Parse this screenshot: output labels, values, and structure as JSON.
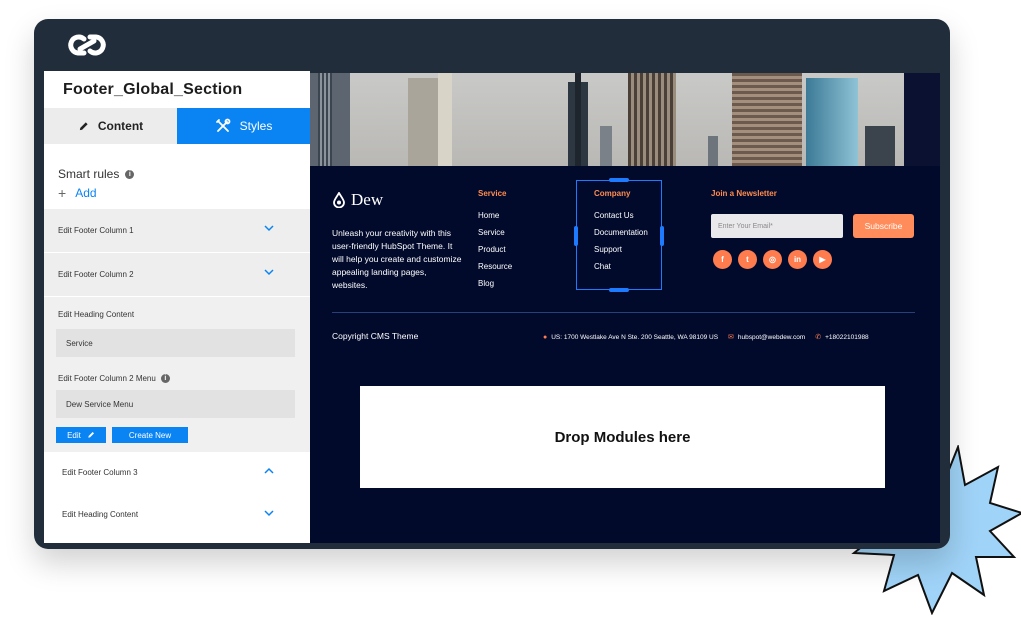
{
  "sidebar": {
    "title": "Footer_Global_Section",
    "tabs": [
      {
        "label": "Content"
      },
      {
        "label": "Styles"
      }
    ],
    "smart_rules_label": "Smart rules",
    "add_label": "Add",
    "rows": [
      {
        "label": "Edit Footer Column 1"
      },
      {
        "label": "Edit Footer Column 2"
      }
    ],
    "expanded": {
      "heading_label": "Edit Heading Content",
      "heading_value": "Service",
      "menu_label": "Edit Footer Column 2 Menu",
      "menu_value": "Dew Service Menu",
      "edit_button": "Edit",
      "create_button": "Create New"
    },
    "after_rows": [
      {
        "label": "Edit Footer Column 3"
      },
      {
        "label": "Edit Heading Content"
      }
    ]
  },
  "footer": {
    "brand": "Dew",
    "blurb": "Unleash your creativity with this user-friendly HubSpot Theme. It will help you create and customize appealing landing pages, websites.",
    "service": {
      "heading": "Service",
      "items": [
        "Home",
        "Service",
        "Product",
        "Resource",
        "Blog"
      ]
    },
    "company": {
      "heading": "Company",
      "items": [
        "Contact Us",
        "Documentation",
        "Support",
        "Chat"
      ]
    },
    "newsletter": {
      "heading": "Join a Newsletter",
      "placeholder": "Enter Your Email*",
      "button": "Subscribe"
    },
    "socials": [
      "facebook-icon",
      "twitter-icon",
      "instagram-icon",
      "linkedin-icon",
      "youtube-icon"
    ],
    "copyright": "Copyright CMS Theme",
    "address": "US: 1700 Westlake Ave N Ste. 200 Seattle, WA 98109 US",
    "email": "hubspot@webdew.com",
    "phone": "+18022101988"
  },
  "drop_zone": "Drop Modules here",
  "colors": {
    "accent_blue": "#0b84f3",
    "footer_bg": "#020a2c",
    "orange": "#ff8c4e",
    "frame": "#222d3b",
    "starburst": "#9fd3f7"
  }
}
